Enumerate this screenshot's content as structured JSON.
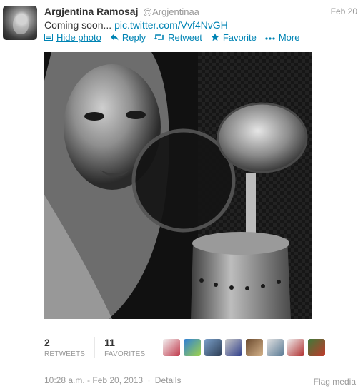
{
  "tweet": {
    "fullname": "Argjentina Ramosaj",
    "username": "@Argjentinaa",
    "date": "Feb 20",
    "text": "Coming soon...",
    "link": "pic.twitter.com/Vvf4NvGH"
  },
  "actions": {
    "hide_photo": "Hide photo",
    "reply": "Reply",
    "retweet": "Retweet",
    "favorite": "Favorite",
    "more": "More"
  },
  "stats": {
    "retweets_count": "2",
    "retweets_label": "RETWEETS",
    "favorites_count": "11",
    "favorites_label": "FAVORITES"
  },
  "footer": {
    "timestamp": "10:28 a.m. - Feb 20, 2013",
    "details": "Details",
    "flag": "Flag media"
  },
  "colors": {
    "link": "#0084b4",
    "muted": "#999999",
    "text": "#333333"
  },
  "icons": {
    "hide_photo": "photo-icon",
    "reply": "reply-arrow-icon",
    "retweet": "retweet-icon",
    "favorite": "star-icon",
    "more": "ellipsis-icon"
  }
}
